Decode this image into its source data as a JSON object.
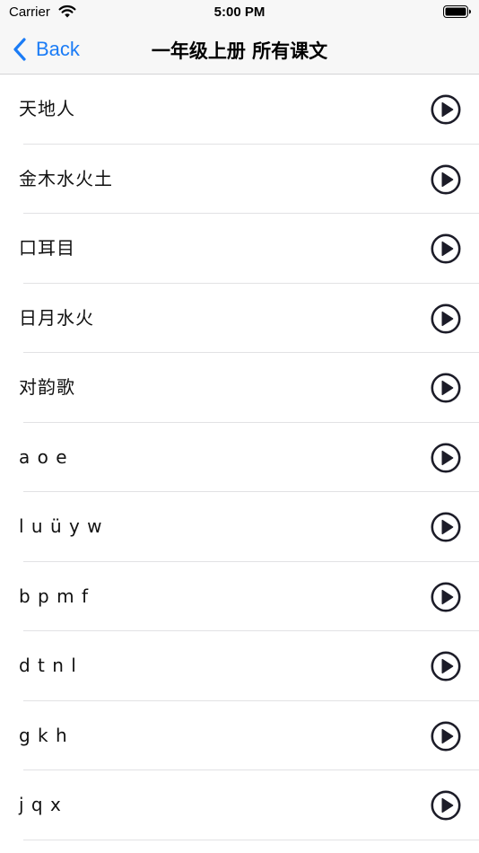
{
  "status_bar": {
    "carrier": "Carrier",
    "time": "5:00 PM"
  },
  "nav": {
    "back_label": "Back",
    "title": "一年级上册 所有课文"
  },
  "lessons": [
    {
      "title": "天地人"
    },
    {
      "title": "金木水火土"
    },
    {
      "title": "口耳目"
    },
    {
      "title": "日月水火"
    },
    {
      "title": "对韵歌"
    },
    {
      "title": "a o e"
    },
    {
      "title": "l u ü y w"
    },
    {
      "title": "b p m f"
    },
    {
      "title": "d t n l"
    },
    {
      "title": "g k h"
    },
    {
      "title": "j q x"
    }
  ],
  "colors": {
    "accent": "#1b7cf6",
    "icon": "#1c1c28",
    "bar_background": "#f7f7f7",
    "separator": "#e2e2e4"
  },
  "icons": {
    "back": "chevron-left-icon",
    "play": "play-circle-icon",
    "wifi": "wifi-icon",
    "battery": "battery-icon"
  }
}
